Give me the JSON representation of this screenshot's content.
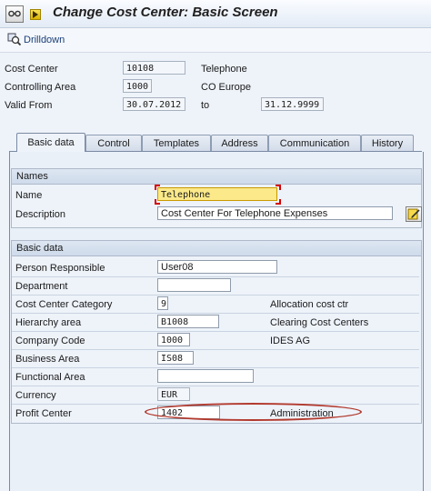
{
  "title": "Change Cost Center: Basic Screen",
  "toolbar": {
    "drilldown": "Drilldown"
  },
  "header": {
    "cost_center": {
      "label": "Cost Center",
      "value": "10108",
      "desc": "Telephone"
    },
    "controlling_area": {
      "label": "Controlling Area",
      "value": "1000",
      "desc": "CO Europe"
    },
    "valid_from": {
      "label": "Valid From",
      "value": "30.07.2012",
      "to_label": "to",
      "to_value": "31.12.9999"
    }
  },
  "tabs": [
    "Basic data",
    "Control",
    "Templates",
    "Address",
    "Communication",
    "History"
  ],
  "names_group": {
    "title": "Names",
    "name_label": "Name",
    "name_value": "Telephone",
    "desc_label": "Description",
    "desc_value": "Cost Center For Telephone Expenses"
  },
  "basic_group": {
    "title": "Basic data",
    "rows": [
      {
        "label": "Person Responsible",
        "value": "User08",
        "desc": ""
      },
      {
        "label": "Department",
        "value": "",
        "desc": ""
      },
      {
        "label": "Cost Center Category",
        "value": "9",
        "desc": "Allocation cost ctr"
      },
      {
        "label": "Hierarchy area",
        "value": "B1008",
        "desc": "Clearing Cost Centers"
      },
      {
        "label": "Company Code",
        "value": "1000",
        "desc": "IDES AG"
      },
      {
        "label": "Business Area",
        "value": "IS08",
        "desc": ""
      },
      {
        "label": "Functional Area",
        "value": "",
        "desc": ""
      },
      {
        "label": "Currency",
        "value": "EUR",
        "desc": ""
      },
      {
        "label": "Profit Center",
        "value": "1402",
        "desc": "Administration"
      }
    ]
  },
  "icons": {
    "title_icon": "glasses-icon",
    "menu_arrow": "dropdown-arrow-icon",
    "drilldown": "drilldown-icon",
    "edit": "edit-note-icon"
  },
  "colors": {
    "highlight_field": "#fbe98a",
    "annotation_ellipse": "#b23a2e"
  }
}
